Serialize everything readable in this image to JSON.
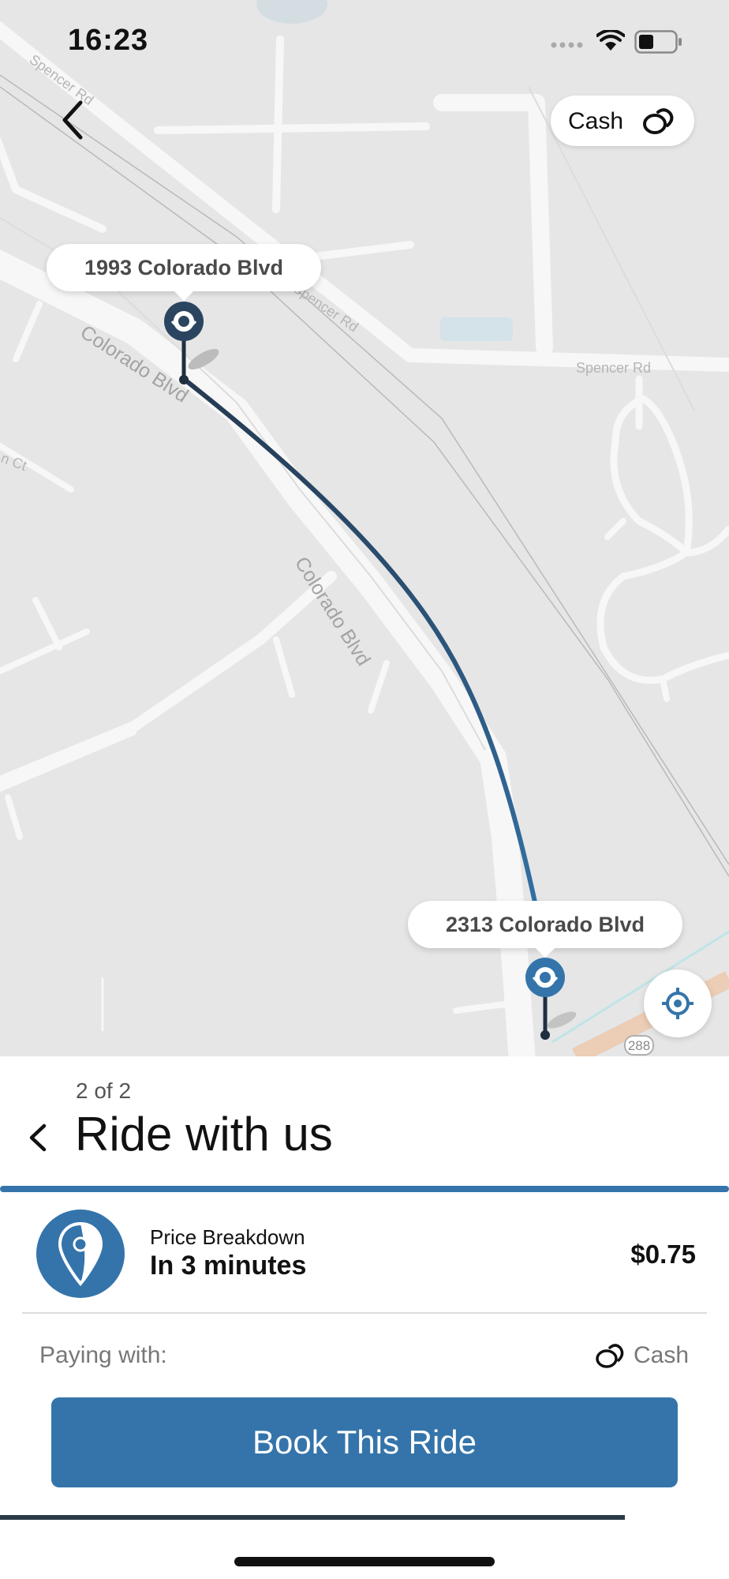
{
  "status_bar": {
    "time": "16:23"
  },
  "header": {
    "back_icon": "chevron-left-icon",
    "payment_method": "Cash",
    "payment_icon": "cash-icon"
  },
  "map": {
    "street_labels": [
      "Spencer Rd",
      "Spencer Rd",
      "Spencer Rd",
      "Colorado Blvd",
      "Colorado Blvd",
      "n Ct",
      "288"
    ],
    "pickup": {
      "address": "1993 Colorado Blvd"
    },
    "dropoff": {
      "address": "2313 Colorado Blvd"
    },
    "locate_icon": "crosshair-icon",
    "route_color": "#2b4560",
    "accent_color": "#3474aa"
  },
  "sheet": {
    "step": "2 of 2",
    "title": "Ride with us",
    "ride": {
      "price_label": "Price Breakdown",
      "eta": "In 3 minutes",
      "price": "$0.75",
      "icon": "location-pin-icon"
    },
    "paying_label": "Paying with:",
    "paying_value": "Cash",
    "book_label": "Book This Ride"
  }
}
